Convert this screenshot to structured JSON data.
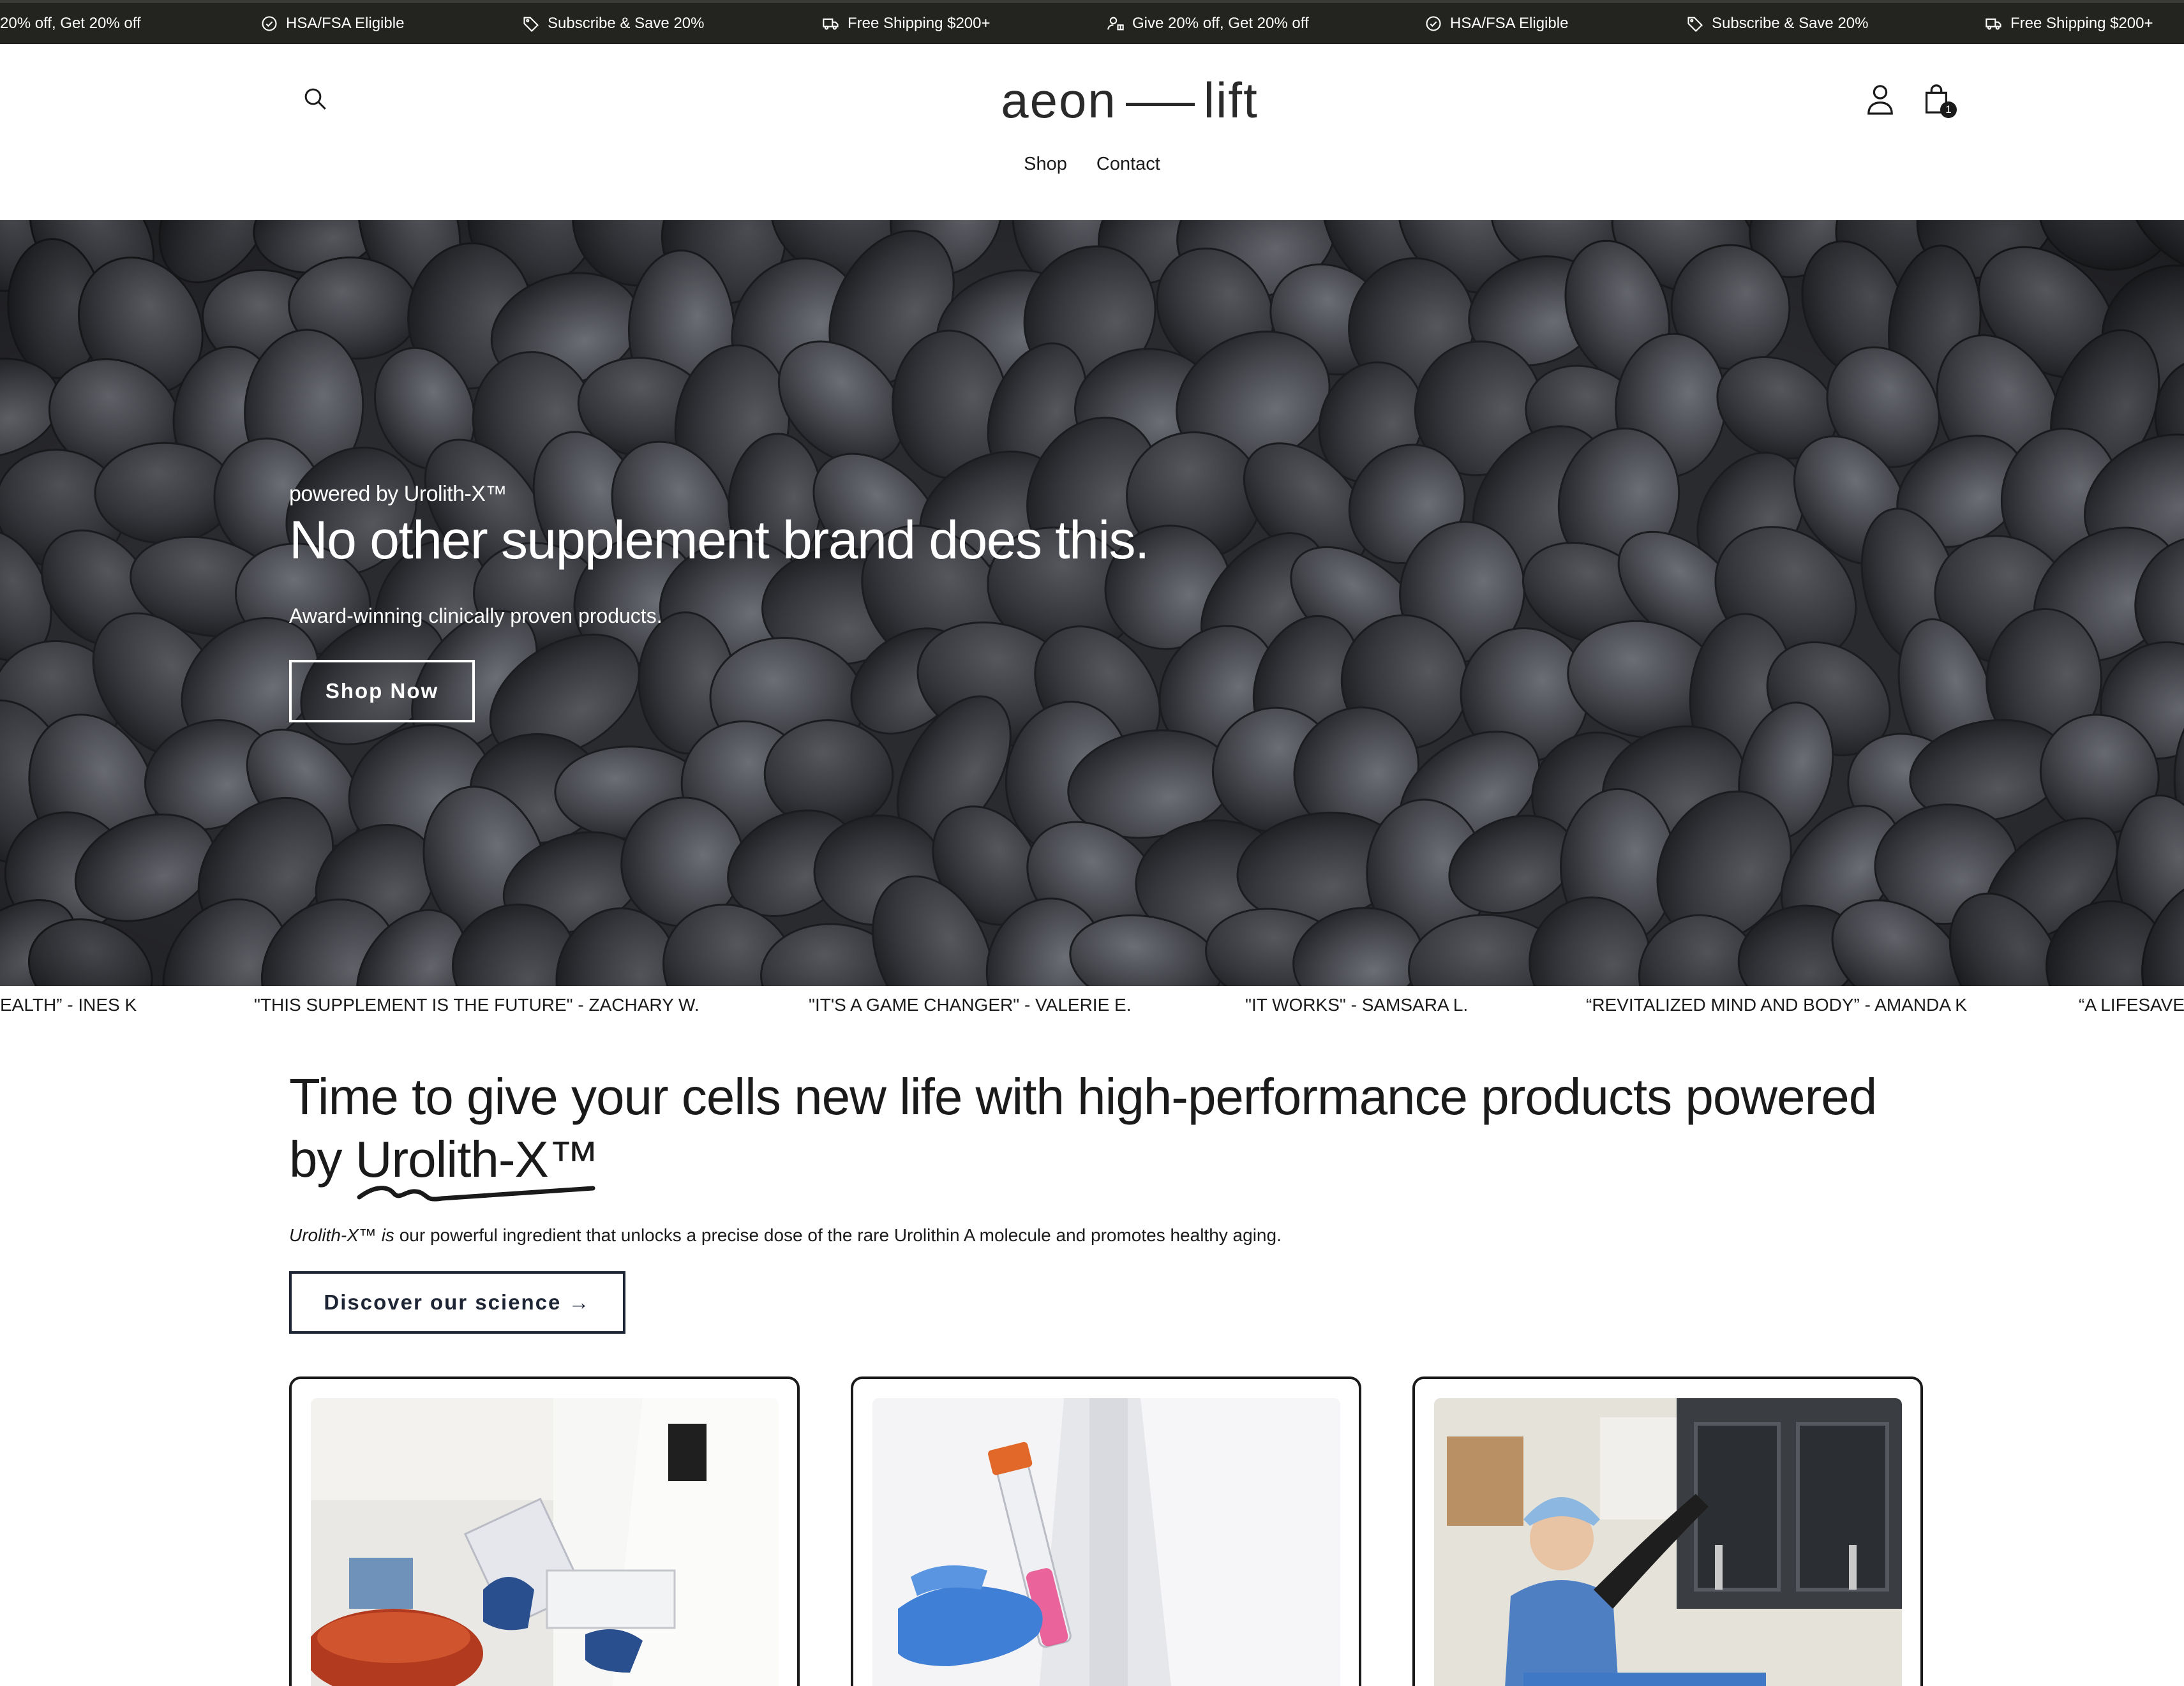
{
  "announcement_bar": {
    "items": [
      {
        "icon": "user-gift-icon",
        "text": "20% off, Get 20% off"
      },
      {
        "icon": "check-badge-icon",
        "text": "HSA/FSA Eligible"
      },
      {
        "icon": "tag-icon",
        "text": "Subscribe & Save 20%"
      },
      {
        "icon": "truck-icon",
        "text": "Free Shipping $200+"
      },
      {
        "icon": "user-gift-icon",
        "text": "Give 20% off, Get 20% off"
      },
      {
        "icon": "check-badge-icon",
        "text": "HSA/FSA Eligible"
      },
      {
        "icon": "tag-icon",
        "text": "Subscribe & Save 20%"
      },
      {
        "icon": "truck-icon",
        "text": "Free Shipping $200+"
      }
    ]
  },
  "header": {
    "logo_left": "aeon",
    "logo_right": "lift",
    "cart_count": "1",
    "icons": [
      "search-icon",
      "account-icon",
      "cart-icon"
    ],
    "nav": [
      {
        "label": "Shop"
      },
      {
        "label": "Contact"
      }
    ]
  },
  "hero": {
    "eyebrow": "powered by Urolith-X™",
    "title": "No other supplement brand does this.",
    "subtitle": "Award-winning clinically proven products.",
    "cta_label": "Shop Now"
  },
  "testimonials": [
    "EALTH” - INES K",
    "\"THIS SUPPLEMENT IS THE FUTURE\" - ZACHARY W.",
    "\"IT'S A GAME CHANGER\" - VALERIE E.",
    "\"IT WORKS\" - SAMSARA L.",
    "“REVITALIZED MIND AND BODY” - AMANDA K",
    "“A LIFESAVER"
  ],
  "intro": {
    "heading": "Time to give your cells new life with high-performance products powered by",
    "heading_brand": "Urolith-X™",
    "desc_italic": "Urolith-X™ is",
    "desc_rest": " our powerful ingredient that unlocks a precise dose of the rare Urolithin A molecule and promotes healthy aging.",
    "cta_label": "Discover our science →"
  },
  "colors": {
    "announcement_bg": "#23241f",
    "hero_bg": "#2c2d31",
    "button_navy": "#1d2433",
    "text": "#1a1a1a"
  }
}
